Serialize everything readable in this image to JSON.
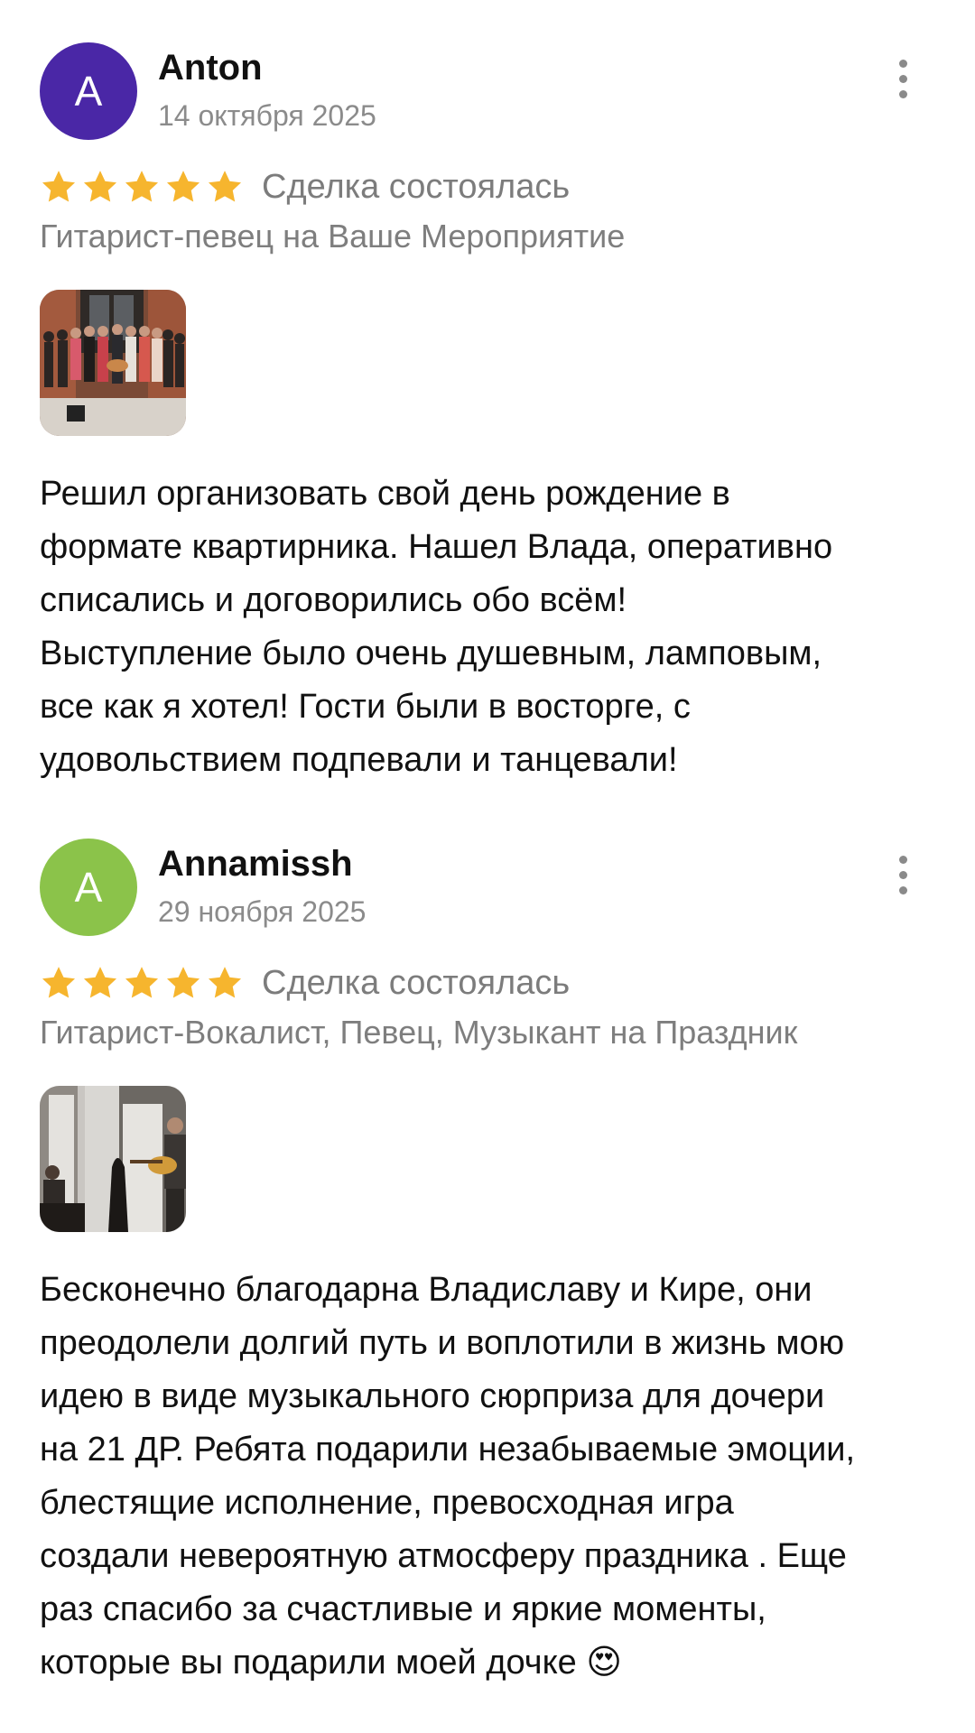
{
  "reviews": [
    {
      "avatar_letter": "A",
      "avatar_color": "#4a27a6",
      "author": "Anton",
      "date": "14 октября 2025",
      "rating": 5,
      "deal_status": "Сделка состоялась",
      "service": "Гитарист-певец на Ваше Мероприятие",
      "photo_icon": "group-photo",
      "text": "Решил организовать свой день рождение в\nформате квартирника. Нашел Влада, оперативно\nсписались и договорились обо всём!\nВыступление было очень душевным, ламповым,\nвсе как я хотел! Гости были в восторге, с\nудовольствием подпевали и танцевали!"
    },
    {
      "avatar_letter": "A",
      "avatar_color": "#8bc34a",
      "author": "Annamissh",
      "date": "29 ноября 2025",
      "rating": 5,
      "deal_status": "Сделка состоялась",
      "service": "Гитарист-Вокалист, Певец, Музыкант на Праздник",
      "photo_icon": "guitarist-photo",
      "text": "Бесконечно благодарна Владиславу и Кире, они\nпреодолели долгий путь и воплотили в жизнь мою\nидею в виде музыкального сюрприза для дочери\nна 21 ДР. Ребята подарили незабываемые эмоции,\nблестящие исполнение, превосходная игра\nсоздали невероятную атмосферу праздника . Еще\nраз спасибо за счастливые и яркие моменты,\nкоторые вы подарили моей дочке 😍"
    }
  ],
  "colors": {
    "star": "#f6b52e",
    "secondary_text": "#7e7e7e",
    "primary_text": "#111111"
  }
}
